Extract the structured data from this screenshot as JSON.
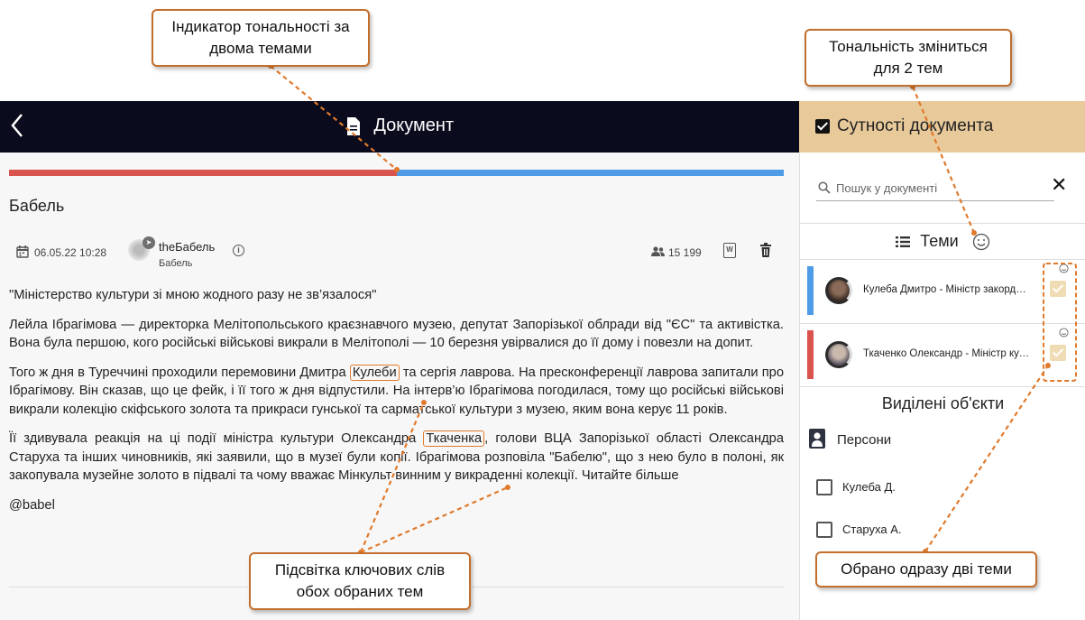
{
  "header": {
    "back_icon": "chevron-left-icon",
    "title": "Документ",
    "title_icon": "document-icon"
  },
  "side_header": {
    "title": "Сутності документа"
  },
  "tone": {
    "red_fraction": 0.5,
    "colors": {
      "negative": "#d9534f",
      "positive": "#4f9ce6"
    }
  },
  "doc": {
    "source": "Бабель",
    "date": "06.05.22 10:28",
    "channel_name": "theБабель",
    "channel_sub": "Бабель",
    "subscribers": "15 199",
    "paragraphs": [
      {
        "plain": "\"Міністерство культури зі мною жодного разу не зв’язалося\""
      },
      {
        "plain": "Лейла Ібрагімова — директорка Мелітопольського краєзнавчого музею, депутат Запорізької облради від \"ЄС\" та активістка. Вона була першою, кого російські військові викрали в Мелітополі — 10 березня увірвалися до її дому і повезли на допит."
      },
      {
        "before": "Того ж дня в Туреччині проходили перемовини Дмитра ",
        "keyword": "Кулеби",
        "after": " та сергія лаврова. На пресконференції лаврова запитали про Ібрагімову. Він сказав, що це фейк, і її того ж дня відпустили. На інтерв’ю Ібрагімова погодилася, тому що російські військові викрали колекцію скіфського золота та прикраси гунської та сарматської культури з музею, яким вона керує 11 років."
      },
      {
        "before": "Її здивувала реакція на ці події міністра культури Олександра ",
        "keyword": "Ткаченка",
        "after": ", голови ВЦА Запорізької області Олександра Старуха та інших чиновників, які заявили, що в музеї були копії. Ібрагімова розповіла \"Бабелю\", що з нею було в полоні, як закопувала музейне золото в підвалі та чому вважає Мінкульт винним у викраденні колекції. Читайте більше"
      },
      {
        "plain": "@babel"
      }
    ]
  },
  "search": {
    "placeholder": "Пошук у документі"
  },
  "topics": {
    "title": "Теми",
    "items": [
      {
        "name": "Кулеба Дмитро - Міністр закордонних справ України",
        "color": "#4f9ce6",
        "checked": true
      },
      {
        "name": "Ткаченко Олександр - Міністр культури",
        "color": "#d9534f",
        "checked": true
      }
    ]
  },
  "selected": {
    "title": "Виділені об'єкти",
    "persons_label": "Персони",
    "persons": [
      {
        "name": "Кулеба Д.",
        "checked": false
      },
      {
        "name": "Старуха А.",
        "checked": false
      }
    ]
  },
  "callouts": {
    "tone_indicator": "Індикатор тональності за двома темами",
    "tone_change": "Тональність зміниться для 2 тем",
    "highlight": "Підсвітка ключових слів обох обраних тем",
    "two_topics": "Обрано одразу дві теми"
  }
}
